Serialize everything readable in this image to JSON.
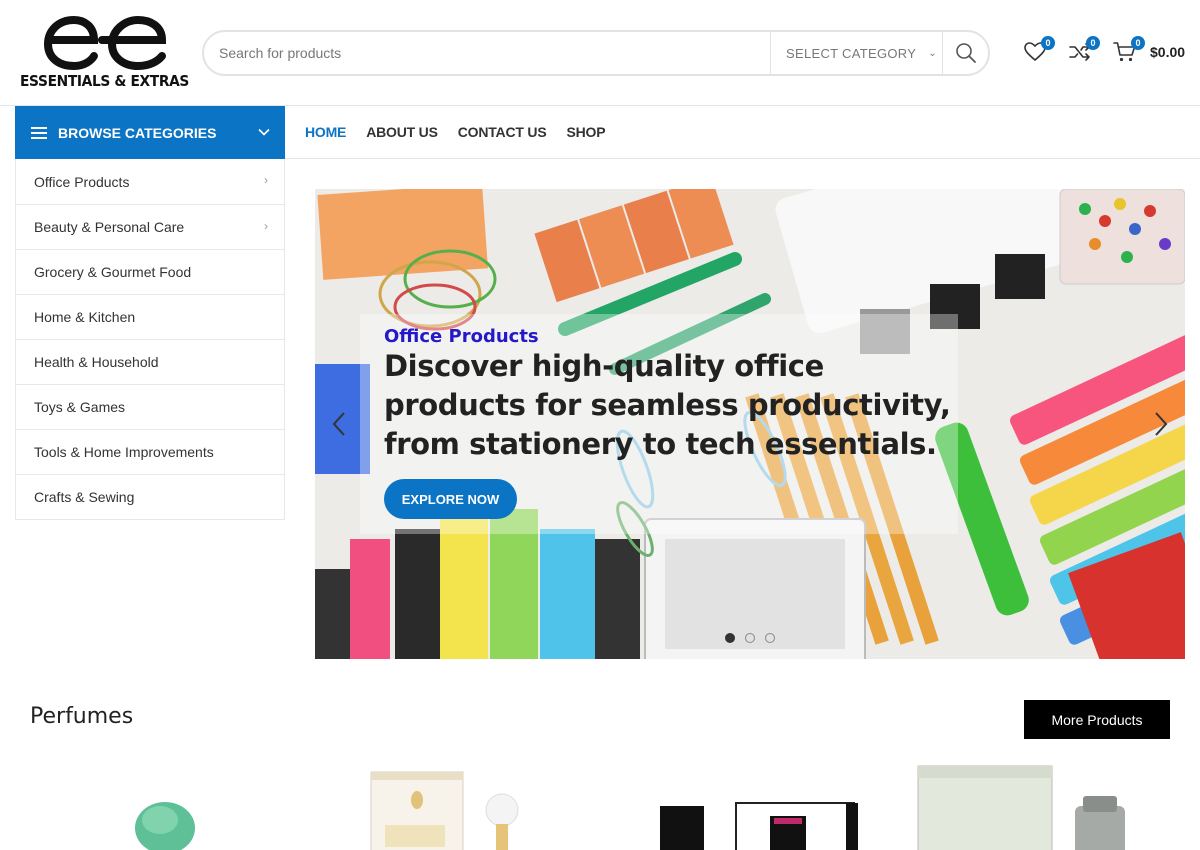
{
  "brand": {
    "logo_text": "ESSENTIALS & EXTRAS"
  },
  "search": {
    "placeholder": "Search for products",
    "category_label": "SELECT CATEGORY"
  },
  "header": {
    "wishlist_count": "0",
    "compare_count": "0",
    "cart_count": "0",
    "cart_total": "$0.00"
  },
  "browse": {
    "label": "BROWSE CATEGORIES"
  },
  "nav": {
    "items": [
      {
        "label": "HOME"
      },
      {
        "label": "ABOUT US"
      },
      {
        "label": "CONTACT US"
      },
      {
        "label": "SHOP"
      }
    ]
  },
  "categories": [
    {
      "label": "Office Products"
    },
    {
      "label": "Beauty & Personal Care"
    },
    {
      "label": "Grocery & Gourmet Food"
    },
    {
      "label": "Home & Kitchen"
    },
    {
      "label": "Health & Household"
    },
    {
      "label": "Toys & Games"
    },
    {
      "label": "Tools & Home Improvements"
    },
    {
      "label": "Crafts & Sewing"
    }
  ],
  "hero": {
    "subtitle": "Office Products",
    "title": "Discover high-quality office products for seamless productivity, from stationery to tech essentials.",
    "button": "EXPLORE NOW",
    "slides": 3,
    "active_slide": 1
  },
  "section": {
    "title": "Perfumes",
    "more_button": "More Products"
  },
  "colors": {
    "accent": "#0b74c4",
    "hero_subtitle": "#2418c9"
  }
}
